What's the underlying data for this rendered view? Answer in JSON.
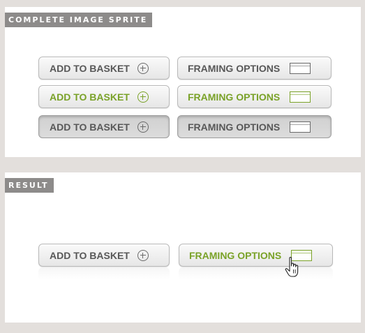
{
  "sprite_section": {
    "label": "COMPLETE IMAGE SPRITE",
    "rows": [
      {
        "state": "normal",
        "basket_label": "ADD TO BASKET",
        "framing_label": "FRAMING OPTIONS"
      },
      {
        "state": "hover",
        "basket_label": "ADD TO BASKET",
        "framing_label": "FRAMING OPTIONS"
      },
      {
        "state": "pressed",
        "basket_label": "ADD TO BASKET",
        "framing_label": "FRAMING OPTIONS"
      }
    ]
  },
  "result_section": {
    "label": "RESULT",
    "basket_label": "ADD TO BASKET",
    "framing_label": "FRAMING OPTIONS"
  },
  "colors": {
    "background": "#e3dfdc",
    "label_bg": "#8d8b8a",
    "text_normal": "#585858",
    "text_hover": "#7aa228"
  },
  "icons": {
    "basket": "plus-circle-icon",
    "framing": "frame-icon",
    "cursor": "hand-pointer-icon"
  }
}
